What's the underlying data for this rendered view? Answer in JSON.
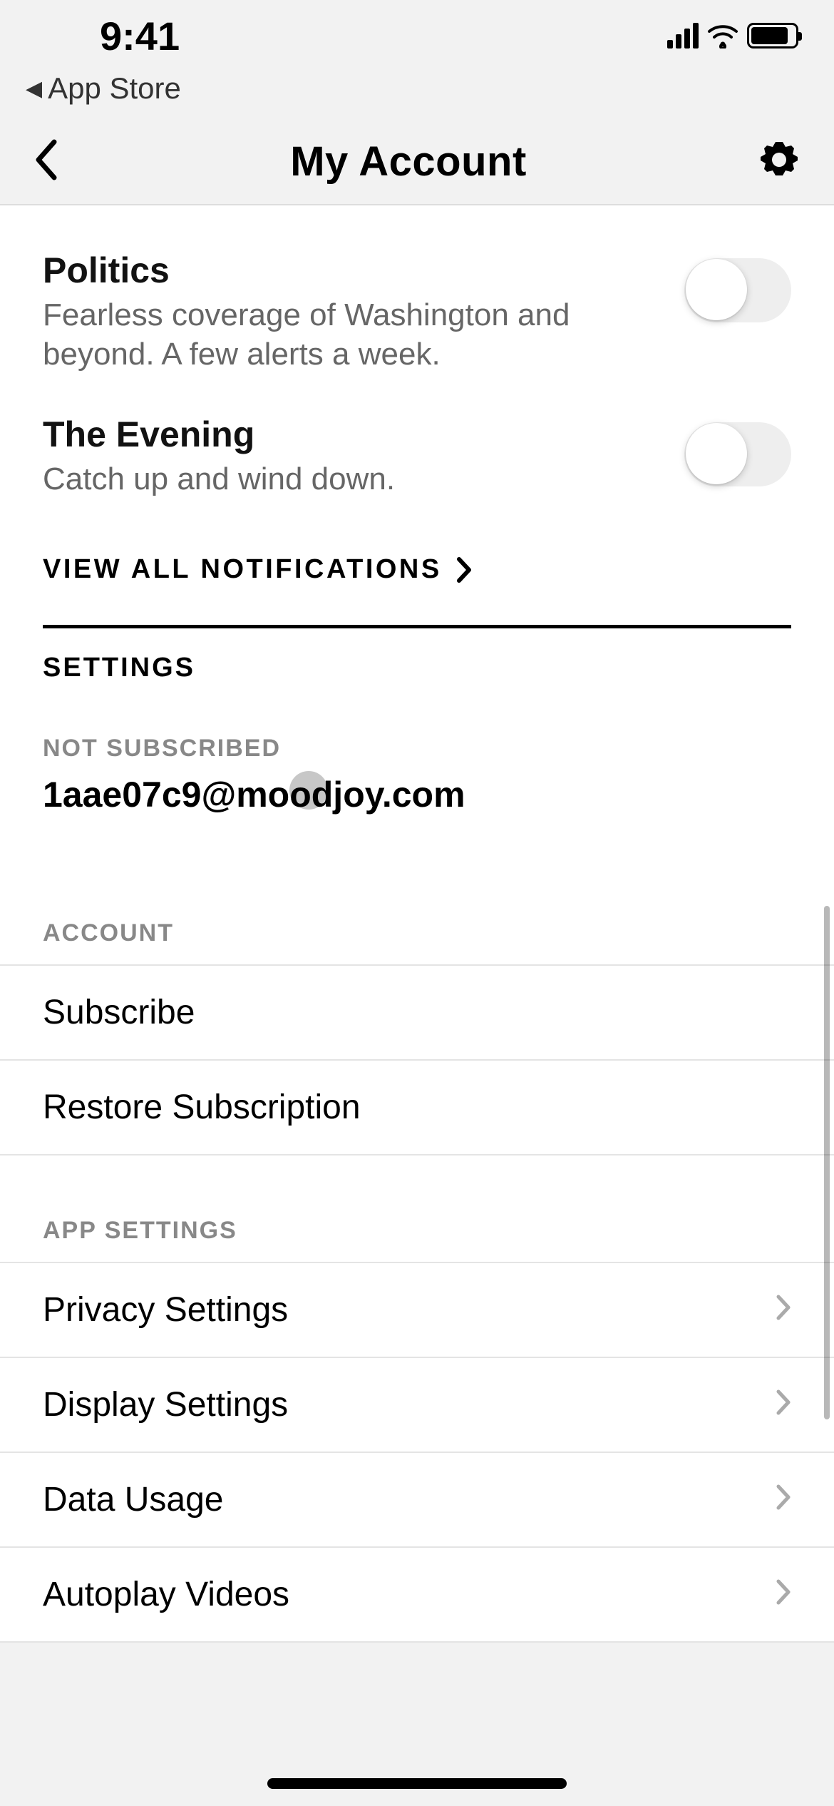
{
  "status": {
    "time": "9:41",
    "breadcrumb_label": "App Store"
  },
  "header": {
    "title": "My Account"
  },
  "notifications": [
    {
      "title": "Politics",
      "description": "Fearless coverage of Washington and beyond. A few alerts a week."
    },
    {
      "title": "The Evening",
      "description": "Catch up and wind down."
    }
  ],
  "view_all_label": "VIEW ALL NOTIFICATIONS",
  "settings_heading": "SETTINGS",
  "subscription_status": "NOT SUBSCRIBED",
  "email": "1aae07c9@moodjoy.com",
  "groups": {
    "account": {
      "label": "ACCOUNT",
      "items": [
        "Subscribe",
        "Restore Subscription"
      ]
    },
    "app_settings": {
      "label": "APP SETTINGS",
      "items": [
        "Privacy Settings",
        "Display Settings",
        "Data Usage",
        "Autoplay Videos"
      ]
    }
  }
}
